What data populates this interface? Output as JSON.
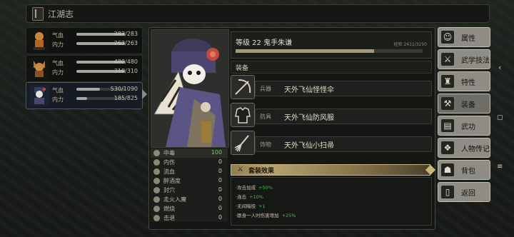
{
  "header": {
    "title": "江湖志"
  },
  "team": [
    {
      "hp_label": "气血",
      "hp": "283/283",
      "hp_frac": 1.0,
      "mp_label": "内力",
      "mp": "263/263",
      "mp_frac": 1.0
    },
    {
      "hp_label": "气血",
      "hp": "480/480",
      "hp_frac": 1.0,
      "mp_label": "内力",
      "mp": "310/310",
      "mp_frac": 1.0
    },
    {
      "hp_label": "气血",
      "hp": "530/1090",
      "hp_frac": 0.49,
      "mp_label": "内力",
      "mp": "185/825",
      "mp_frac": 0.22
    }
  ],
  "character": {
    "level_text": "等级 22  鬼手朱谦",
    "xp_text": "经验 2411/3250",
    "xp_frac": 0.74
  },
  "stats": [
    {
      "name": "中毒",
      "value": "100"
    },
    {
      "name": "内伤",
      "value": "0"
    },
    {
      "name": "流血",
      "value": "0"
    },
    {
      "name": "醉酒度",
      "value": "0"
    },
    {
      "name": "封穴",
      "value": "0"
    },
    {
      "name": "走火入魔",
      "value": "0"
    },
    {
      "name": "燃烧",
      "value": "0"
    },
    {
      "name": "击退",
      "value": "0"
    }
  ],
  "equipment": {
    "section_label": "装备",
    "items": [
      {
        "type": "兵器",
        "name": "天外飞仙怪怪伞",
        "icon": "umbrella-weapon-icon"
      },
      {
        "type": "防具",
        "name": "天外飞仙防风服",
        "icon": "armor-icon"
      },
      {
        "type": "饰物",
        "name": "天外飞仙小扫帚",
        "icon": "broom-icon"
      }
    ]
  },
  "set_bonus": {
    "label": "套装效果",
    "effects": [
      {
        "text": "·攻击加成",
        "value": "+50%"
      },
      {
        "text": "·连击",
        "value": "+10%"
      },
      {
        "text": "·无间暗技",
        "value": "+1"
      },
      {
        "text": "·跟身一人时伤害增加",
        "value": "+25%"
      }
    ]
  },
  "menu": [
    {
      "label": "属性",
      "icon": "attributes-icon",
      "glyph": "☺"
    },
    {
      "label": "武学技法",
      "icon": "martial-arts-icon",
      "glyph": "⚔"
    },
    {
      "label": "特性",
      "icon": "traits-icon",
      "glyph": "♜"
    },
    {
      "label": "装备",
      "icon": "equipment-icon",
      "glyph": "⚒"
    },
    {
      "label": "武功",
      "icon": "kungfu-icon",
      "glyph": "▤"
    },
    {
      "label": "人物传记",
      "icon": "biography-icon",
      "glyph": "❖"
    },
    {
      "label": "背包",
      "icon": "backpack-icon",
      "glyph": "☗"
    },
    {
      "label": "返回",
      "icon": "return-icon",
      "glyph": "▯"
    }
  ],
  "colors": {
    "accent_gold": "#c9b47b",
    "positive_green": "#4fb849",
    "poison_green": "#6fd16a"
  }
}
